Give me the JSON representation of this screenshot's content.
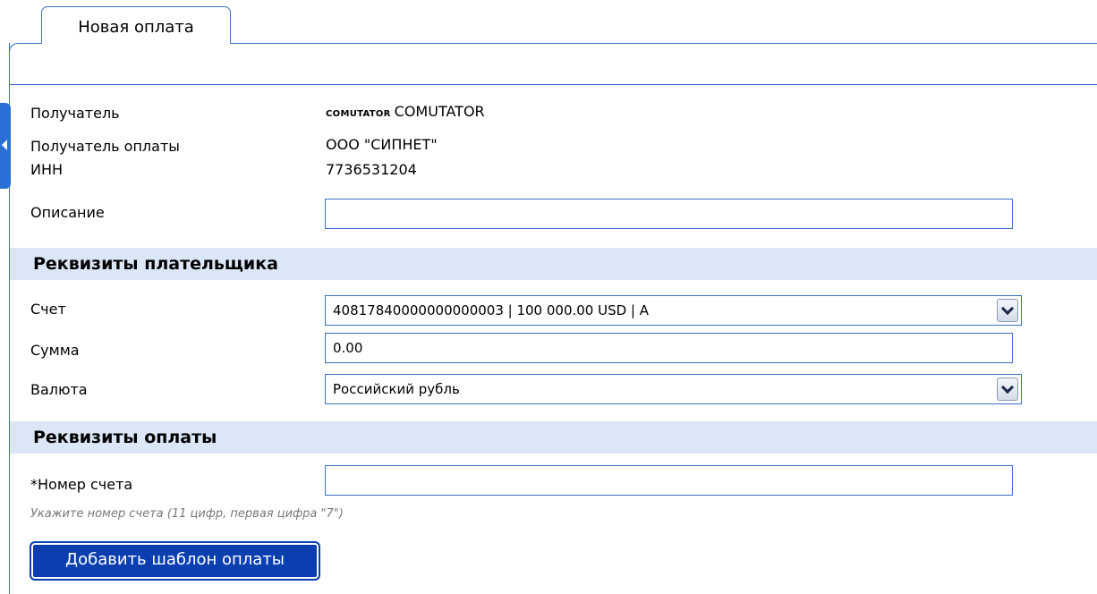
{
  "tab": {
    "label": "Новая оплата"
  },
  "recipient": {
    "label": "Получатель",
    "logo_text": "COMUTATOR",
    "name": "COMUTATOR"
  },
  "payee": {
    "label": "Получатель оплаты",
    "value": "ООО \"СИПНЕТ\""
  },
  "inn": {
    "label": "ИНН",
    "value": "7736531204"
  },
  "description": {
    "label": "Описание",
    "value": "",
    "placeholder": ""
  },
  "payer_section": {
    "title": "Реквизиты плательщика",
    "account": {
      "label": "Счет",
      "selected": "40817840000000000003 | 100 000.00 USD | A"
    },
    "amount": {
      "label": "Сумма",
      "value": "0.00"
    },
    "currency": {
      "label": "Валюта",
      "selected": "Российский рубль"
    }
  },
  "payment_section": {
    "title": "Реквизиты оплаты",
    "account_number": {
      "label": "*Номер счета",
      "value": "",
      "hint": "Укажите номер счета (11 цифр, первая цифра \"7\")"
    }
  },
  "add_template_button": {
    "label": "Добавить шаблон оплаты"
  },
  "colors": {
    "accent": "#3a6fc4",
    "section_bg": "#dbe6f6",
    "button_bg": "#0b3fb0",
    "handle": "#2a6fd6"
  },
  "icons": [
    "chevron-left-icon",
    "chevron-down-icon"
  ]
}
